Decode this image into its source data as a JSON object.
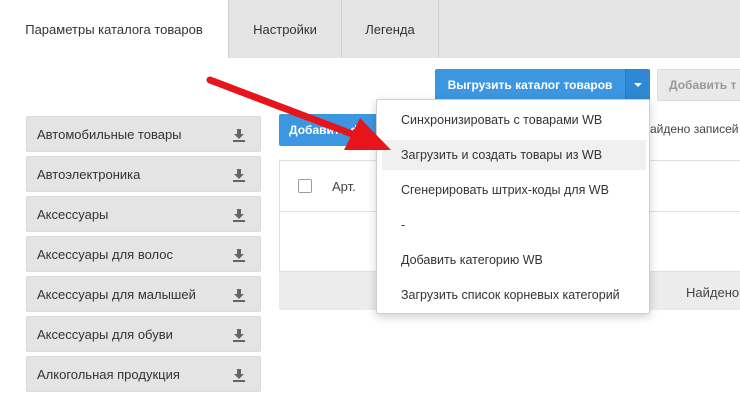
{
  "tabs": [
    {
      "label": "Параметры каталога товаров",
      "active": true
    },
    {
      "label": "Настройки",
      "active": false
    },
    {
      "label": "Легенда",
      "active": false
    }
  ],
  "categories": [
    {
      "label": "Автомобильные товары",
      "icon": "download-icon"
    },
    {
      "label": "Автоэлектроника",
      "icon": "download-icon"
    },
    {
      "label": "Аксессуары",
      "icon": "download-icon"
    },
    {
      "label": "Аксессуары для волос",
      "icon": "download-icon"
    },
    {
      "label": "Аксессуары для малышей",
      "icon": "download-icon"
    },
    {
      "label": "Аксессуары для обуви",
      "icon": "download-icon"
    },
    {
      "label": "Алкогольная продукция",
      "icon": "download-icon"
    }
  ],
  "toolbar": {
    "export_label": "Выгрузить каталог товаров",
    "add_label": "Добавить т",
    "add_filter_label": "Добавить фи",
    "found_top": "айдено записей"
  },
  "table": {
    "col_art": "Арт.",
    "footer_found": "Найдено"
  },
  "menu": {
    "items": [
      {
        "label": "Синхронизировать с товарами WB"
      },
      {
        "label": "Загрузить и создать товары из WB",
        "highlighted": true
      },
      {
        "label": "Сгенерировать штрих-коды для WB"
      },
      {
        "label": "-"
      },
      {
        "label": "Добавить категорию WB"
      },
      {
        "label": "Загрузить список корневых категорий"
      }
    ]
  },
  "colors": {
    "primary": "#3c96e0",
    "arrow": "#e8141b",
    "tab_bg": "#e4e4e4"
  }
}
